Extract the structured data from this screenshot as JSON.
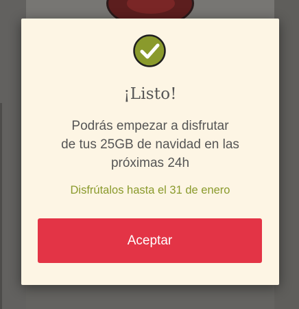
{
  "dialog": {
    "icon": "check-circle-icon",
    "title": "¡Listo!",
    "message_lines": [
      "Podrás empezar a disfrutar",
      "de tus 25GB de navidad en las",
      "próximas 24h"
    ],
    "highlight": "Disfrútalos hasta el 31 de enero",
    "accept_label": "Aceptar"
  },
  "colors": {
    "dialog_background": "#fdf5e4",
    "check_fill": "#8a9a2c",
    "highlight_text": "#8a9a2c",
    "button": "#e33446",
    "overlay": "#646360"
  }
}
